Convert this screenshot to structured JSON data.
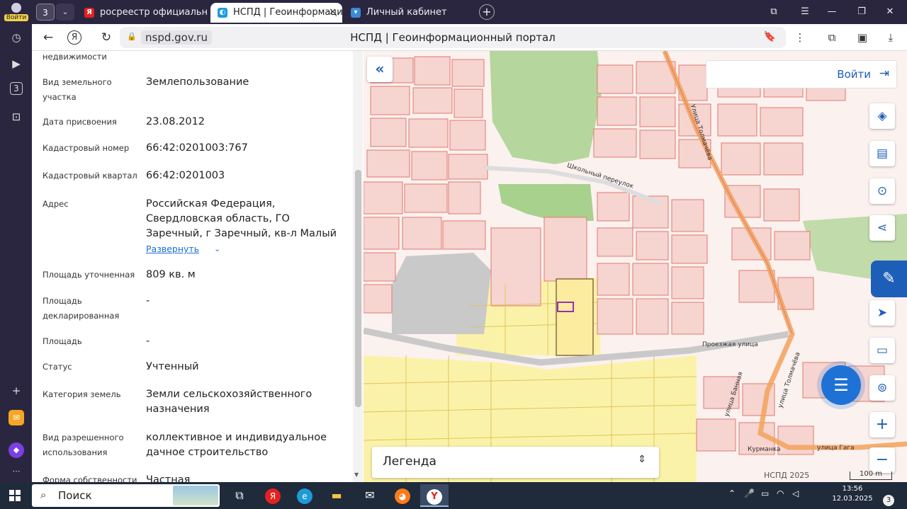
{
  "rail": {
    "login_label": "Войти",
    "icons": [
      "history-icon",
      "play-icon",
      "counter-icon",
      "screenshot-icon",
      "add-icon",
      "mail-app-icon",
      "alice-icon",
      "more-icon"
    ],
    "counter": "3"
  },
  "tabs": {
    "count": "3",
    "items": [
      {
        "label": "росреестр официальный",
        "favicon": "Я",
        "favicon_color": "#e42121",
        "active": false
      },
      {
        "label": "НСПД | Геоинформаци",
        "favicon": "◐",
        "favicon_color": "#1d9be0",
        "active": true
      },
      {
        "label": "Личный кабинет",
        "favicon": "▾",
        "favicon_color": "#3a8ad6",
        "active": false
      }
    ],
    "new_tab": "+",
    "window_buttons": [
      "⧉",
      "☰",
      "—",
      "❐",
      "✕"
    ]
  },
  "address": {
    "url": "nspd.gov.ru",
    "page_title": "НСПД | Геоинформационный портал"
  },
  "panel": {
    "rows": [
      {
        "label": "недвижимости",
        "value": ""
      },
      {
        "label": "Вид земельного участка",
        "value": "Землепользование"
      },
      {
        "label": "Дата присвоения",
        "value": "23.08.2012"
      },
      {
        "label": "Кадастровый номер",
        "value": "66:42:0201003:767"
      },
      {
        "label": "Кадастровый квартал",
        "value": "66:42:0201003"
      },
      {
        "label": "Адрес",
        "value": "Российская Федерация, Свердловская область, ГО Заречный, г Заречный, кв-л Малый"
      },
      {
        "label": "Площадь уточненная",
        "value": "809 кв. м"
      },
      {
        "label": "Площадь декларированная",
        "value": "-"
      },
      {
        "label": "Площадь",
        "value": "-"
      },
      {
        "label": "Статус",
        "value": "Учтенный"
      },
      {
        "label": "Категория земель",
        "value": "Земли сельскохозяйственного назначения"
      },
      {
        "label": "Вид разрешенного использования",
        "value": "коллективное и индивидуальное дачное строительство"
      },
      {
        "label": "Форма собственности",
        "value": "Частная"
      }
    ],
    "expand_link": "Развернуть"
  },
  "map": {
    "login": "Войти",
    "legend": "Легенда",
    "copyright": "НСПД 2025",
    "scale": "100 m",
    "labels": {
      "school_lane": "Школьный переулок",
      "tolmacheva_1": "Улица Толмачёва",
      "tolmacheva_2": "улица Толмачёва",
      "proezd": "Проезжая улица",
      "banny": "улица Банная",
      "gagarina": "улица Гага",
      "kurmanka": "Курманка"
    },
    "colors": {
      "parcel_fill": "#f6d4d0",
      "parcel_stroke": "#e07a6f",
      "garden_fill": "#fbf2a9",
      "green": "#a8d18d",
      "road": "#c9c9c9",
      "main_road": "#f2a25a",
      "selected": "#9b2fae"
    }
  },
  "taskbar": {
    "search": "Поиск",
    "time": "13:56",
    "date": "12.03.2025",
    "notifications": "3",
    "apps": [
      "task-view-icon",
      "yandex-icon",
      "edge-icon",
      "explorer-icon",
      "mail-icon",
      "firefox-icon",
      "yandex-browser-icon"
    ]
  }
}
